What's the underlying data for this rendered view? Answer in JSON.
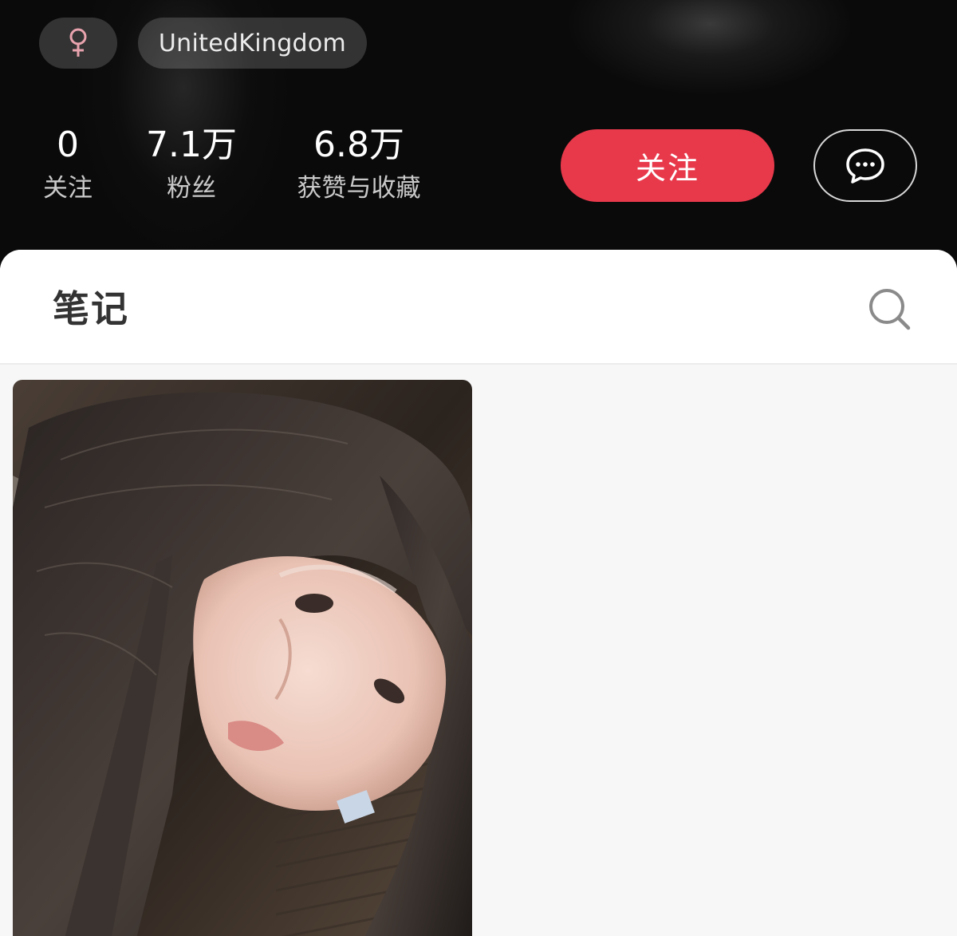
{
  "profile": {
    "gender_symbol": "♀",
    "region": "UnitedKingdom"
  },
  "stats": [
    {
      "value": "0",
      "label": "关注"
    },
    {
      "value": "7.1万",
      "label": "粉丝"
    },
    {
      "value": "6.8万",
      "label": "获赞与收藏"
    }
  ],
  "actions": {
    "follow_label": "关注",
    "message_icon": "chat-bubble-icon"
  },
  "tabs": {
    "notes_label": "笔记",
    "search_icon": "search-icon"
  },
  "colors": {
    "accent": "#e8394b",
    "gender_pink": "#e8a3ae",
    "header_bg": "#0a0a0a",
    "content_bg": "#f7f7f7"
  }
}
